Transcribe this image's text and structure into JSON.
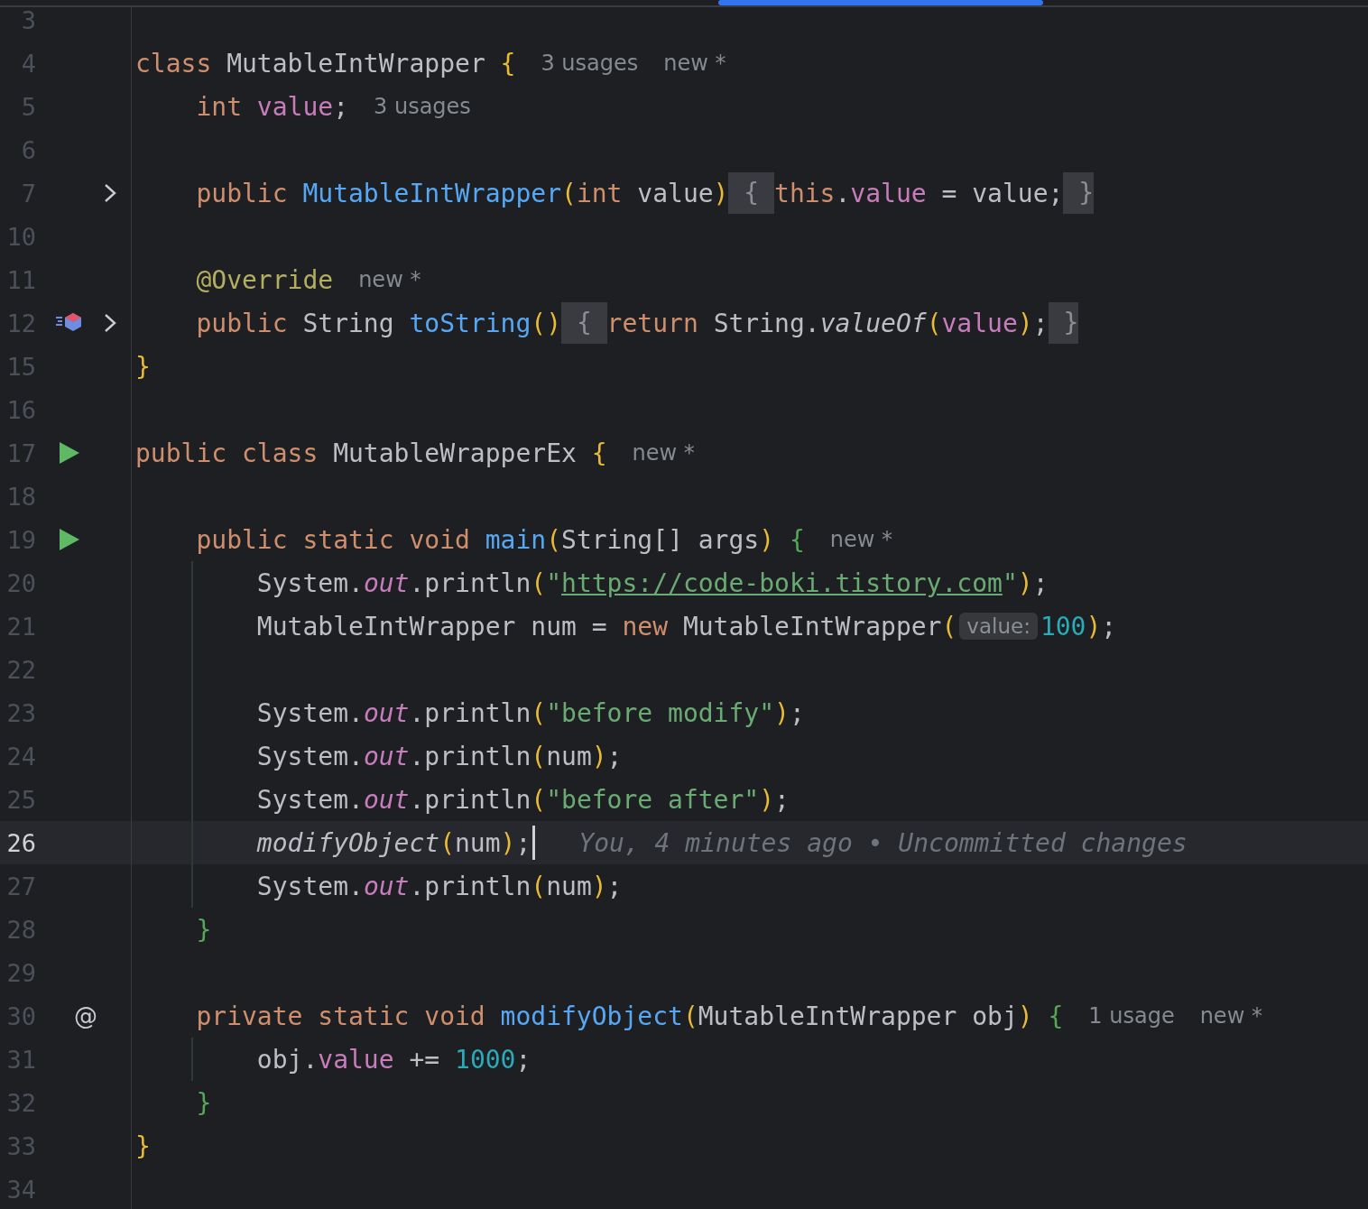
{
  "editor": {
    "lines": [
      {
        "number": "3"
      },
      {
        "number": "4",
        "tokens": [
          {
            "text": "class ",
            "kind": "keyword"
          },
          {
            "text": "MutableIntWrapper ",
            "kind": "plain"
          },
          {
            "text": "{",
            "kind": "bracket-gold"
          },
          {
            "text": "3 usages",
            "kind": "hint"
          },
          {
            "text": "new *",
            "kind": "hint"
          }
        ]
      },
      {
        "number": "5",
        "tokens": [
          {
            "text": "    int ",
            "kind": "keyword"
          },
          {
            "text": "value",
            "kind": "field"
          },
          {
            "text": ";",
            "kind": "plain"
          },
          {
            "text": "3 usages",
            "kind": "hint"
          }
        ]
      },
      {
        "number": "6"
      },
      {
        "number": "7",
        "folded": true,
        "tokens": [
          {
            "text": "    public ",
            "kind": "keyword"
          },
          {
            "text": "MutableIntWrapper",
            "kind": "method"
          },
          {
            "text": "(",
            "kind": "bracket-gold"
          },
          {
            "text": "int ",
            "kind": "keyword"
          },
          {
            "text": "value",
            "kind": "plain"
          },
          {
            "text": ")",
            "kind": "bracket-gold"
          },
          {
            "text": " { ",
            "kind": "fold"
          },
          {
            "text": "this",
            "kind": "keyword"
          },
          {
            "text": ".",
            "kind": "plain"
          },
          {
            "text": "value",
            "kind": "field"
          },
          {
            "text": " = value;",
            "kind": "plain"
          },
          {
            "text": " }",
            "kind": "fold"
          }
        ]
      },
      {
        "number": "10"
      },
      {
        "number": "11",
        "tokens": [
          {
            "text": "    @Override",
            "kind": "annotation"
          },
          {
            "text": "new *",
            "kind": "hint"
          }
        ]
      },
      {
        "number": "12",
        "marker": {
          "kind": "override"
        },
        "folded": true,
        "tokens": [
          {
            "text": "    public ",
            "kind": "keyword"
          },
          {
            "text": "String ",
            "kind": "plain"
          },
          {
            "text": "toString",
            "kind": "method"
          },
          {
            "text": "()",
            "kind": "bracket-gold"
          },
          {
            "text": " { ",
            "kind": "fold"
          },
          {
            "text": "return ",
            "kind": "keyword"
          },
          {
            "text": "String.",
            "kind": "plain"
          },
          {
            "text": "valueOf",
            "kind": "italic"
          },
          {
            "text": "(",
            "kind": "bracket-gold"
          },
          {
            "text": "value",
            "kind": "field"
          },
          {
            "text": ")",
            "kind": "bracket-gold"
          },
          {
            "text": ";",
            "kind": "plain"
          },
          {
            "text": " }",
            "kind": "fold"
          }
        ]
      },
      {
        "number": "15",
        "tokens": [
          {
            "text": "}",
            "kind": "bracket-gold"
          }
        ]
      },
      {
        "number": "16"
      },
      {
        "number": "17",
        "marker": {
          "kind": "run"
        },
        "tokens": [
          {
            "text": "public class ",
            "kind": "keyword"
          },
          {
            "text": "MutableWrapperEx ",
            "kind": "plain"
          },
          {
            "text": "{",
            "kind": "bracket-gold"
          },
          {
            "text": "new *",
            "kind": "hint"
          }
        ]
      },
      {
        "number": "18"
      },
      {
        "number": "19",
        "marker": {
          "kind": "run"
        },
        "tokens": [
          {
            "text": "    public static void ",
            "kind": "keyword"
          },
          {
            "text": "main",
            "kind": "method"
          },
          {
            "text": "(",
            "kind": "bracket-gold"
          },
          {
            "text": "String[] args",
            "kind": "plain"
          },
          {
            "text": ")",
            "kind": "bracket-gold"
          },
          {
            "text": " {",
            "kind": "bracket-green"
          },
          {
            "text": "new *",
            "kind": "hint"
          }
        ]
      },
      {
        "number": "20",
        "guide": true,
        "tokens": [
          {
            "text": "        System.",
            "kind": "plain"
          },
          {
            "text": "out",
            "kind": "static"
          },
          {
            "text": ".println",
            "kind": "plain"
          },
          {
            "text": "(",
            "kind": "bracket-gold"
          },
          {
            "text": "\"",
            "kind": "string"
          },
          {
            "text": "https://code-boki.tistory.com",
            "kind": "link"
          },
          {
            "text": "\"",
            "kind": "string"
          },
          {
            "text": ")",
            "kind": "bracket-gold"
          },
          {
            "text": ";",
            "kind": "plain"
          }
        ]
      },
      {
        "number": "21",
        "guide": true,
        "tokens": [
          {
            "text": "        MutableIntWrapper num = ",
            "kind": "plain"
          },
          {
            "text": "new ",
            "kind": "keyword"
          },
          {
            "text": "MutableIntWrapper",
            "kind": "plain"
          },
          {
            "text": "(",
            "kind": "bracket-gold"
          },
          {
            "text": "value:",
            "kind": "inlay"
          },
          {
            "text": "100",
            "kind": "number"
          },
          {
            "text": ")",
            "kind": "bracket-gold"
          },
          {
            "text": ";",
            "kind": "plain"
          }
        ]
      },
      {
        "number": "22",
        "guide": true
      },
      {
        "number": "23",
        "guide": true,
        "tokens": [
          {
            "text": "        System.",
            "kind": "plain"
          },
          {
            "text": "out",
            "kind": "static"
          },
          {
            "text": ".println",
            "kind": "plain"
          },
          {
            "text": "(",
            "kind": "bracket-gold"
          },
          {
            "text": "\"before modify\"",
            "kind": "string"
          },
          {
            "text": ")",
            "kind": "bracket-gold"
          },
          {
            "text": ";",
            "kind": "plain"
          }
        ]
      },
      {
        "number": "24",
        "guide": true,
        "tokens": [
          {
            "text": "        System.",
            "kind": "plain"
          },
          {
            "text": "out",
            "kind": "static"
          },
          {
            "text": ".println",
            "kind": "plain"
          },
          {
            "text": "(",
            "kind": "bracket-gold"
          },
          {
            "text": "num",
            "kind": "plain"
          },
          {
            "text": ")",
            "kind": "bracket-gold"
          },
          {
            "text": ";",
            "kind": "plain"
          }
        ]
      },
      {
        "number": "25",
        "guide": true,
        "tokens": [
          {
            "text": "        System.",
            "kind": "plain"
          },
          {
            "text": "out",
            "kind": "static"
          },
          {
            "text": ".println",
            "kind": "plain"
          },
          {
            "text": "(",
            "kind": "bracket-gold"
          },
          {
            "text": "\"before after\"",
            "kind": "string"
          },
          {
            "text": ")",
            "kind": "bracket-gold"
          },
          {
            "text": ";",
            "kind": "plain"
          }
        ]
      },
      {
        "number": "26",
        "guide": true,
        "current": true,
        "tokens": [
          {
            "text": "        modifyObject",
            "kind": "italic"
          },
          {
            "text": "(",
            "kind": "bracket-gold"
          },
          {
            "text": "num",
            "kind": "plain"
          },
          {
            "text": ")",
            "kind": "bracket-gold"
          },
          {
            "text": ";",
            "kind": "plain"
          },
          {
            "text": "You, 4 minutes ago • Uncommitted changes",
            "kind": "blame"
          }
        ]
      },
      {
        "number": "27",
        "guide": true,
        "tokens": [
          {
            "text": "        System.",
            "kind": "plain"
          },
          {
            "text": "out",
            "kind": "static"
          },
          {
            "text": ".println",
            "kind": "plain"
          },
          {
            "text": "(",
            "kind": "bracket-gold"
          },
          {
            "text": "num",
            "kind": "plain"
          },
          {
            "text": ")",
            "kind": "bracket-gold"
          },
          {
            "text": ";",
            "kind": "plain"
          }
        ]
      },
      {
        "number": "28",
        "tokens": [
          {
            "text": "    }",
            "kind": "bracket-green"
          }
        ]
      },
      {
        "number": "29"
      },
      {
        "number": "30",
        "marker": {
          "kind": "at",
          "text": "@"
        },
        "tokens": [
          {
            "text": "    private static void ",
            "kind": "keyword"
          },
          {
            "text": "modifyObject",
            "kind": "method"
          },
          {
            "text": "(",
            "kind": "bracket-gold"
          },
          {
            "text": "MutableIntWrapper obj",
            "kind": "plain"
          },
          {
            "text": ")",
            "kind": "bracket-gold"
          },
          {
            "text": " {",
            "kind": "bracket-green"
          },
          {
            "text": "1 usage",
            "kind": "hint"
          },
          {
            "text": "new *",
            "kind": "hint"
          }
        ]
      },
      {
        "number": "31",
        "guide": true,
        "tokens": [
          {
            "text": "        obj.",
            "kind": "plain"
          },
          {
            "text": "value",
            "kind": "field"
          },
          {
            "text": " += ",
            "kind": "plain"
          },
          {
            "text": "1000",
            "kind": "number"
          },
          {
            "text": ";",
            "kind": "plain"
          }
        ]
      },
      {
        "number": "32",
        "tokens": [
          {
            "text": "    }",
            "kind": "bracket-green"
          }
        ]
      },
      {
        "number": "33",
        "tokens": [
          {
            "text": "}",
            "kind": "bracket-gold"
          }
        ]
      },
      {
        "number": "34"
      }
    ]
  }
}
